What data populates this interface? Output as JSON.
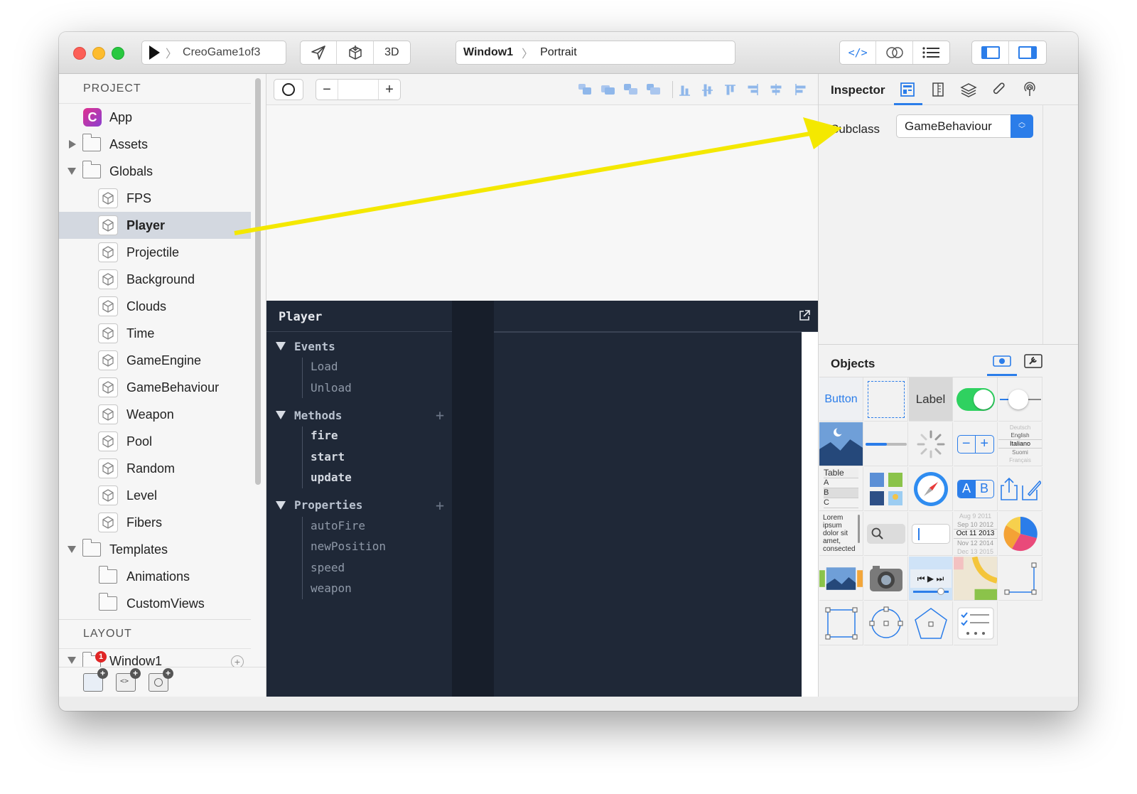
{
  "toolbar": {
    "scheme": "CreoGame1of3",
    "mode_3d": "3D",
    "breadcrumb_window": "Window1",
    "breadcrumb_orientation": "Portrait",
    "code_label": "</>"
  },
  "sidebar": {
    "project_header": "PROJECT",
    "layout_header": "LAYOUT",
    "items": [
      {
        "label": "App",
        "kind": "app"
      },
      {
        "label": "Assets",
        "kind": "folder-closed"
      },
      {
        "label": "Globals",
        "kind": "folder-open"
      },
      {
        "label": "FPS",
        "kind": "class"
      },
      {
        "label": "Player",
        "kind": "class",
        "selected": true
      },
      {
        "label": "Projectile",
        "kind": "class"
      },
      {
        "label": "Background",
        "kind": "class"
      },
      {
        "label": "Clouds",
        "kind": "class"
      },
      {
        "label": "Time",
        "kind": "class"
      },
      {
        "label": "GameEngine",
        "kind": "class"
      },
      {
        "label": "GameBehaviour",
        "kind": "class"
      },
      {
        "label": "Weapon",
        "kind": "class"
      },
      {
        "label": "Pool",
        "kind": "class"
      },
      {
        "label": "Random",
        "kind": "class"
      },
      {
        "label": "Level",
        "kind": "class"
      },
      {
        "label": "Fibers",
        "kind": "class"
      },
      {
        "label": "Templates",
        "kind": "folder-open"
      },
      {
        "label": "Animations",
        "kind": "subfolder"
      },
      {
        "label": "CustomViews",
        "kind": "subfolder"
      }
    ],
    "layout_items": [
      {
        "label": "Window1",
        "badge": "1"
      }
    ],
    "app_icon_letter": "C"
  },
  "editor": {
    "title": "Player",
    "groups": [
      {
        "label": "Events",
        "items": [
          "Load",
          "Unload"
        ],
        "bold": false,
        "addable": false
      },
      {
        "label": "Methods",
        "items": [
          "fire",
          "start",
          "update"
        ],
        "bold": true,
        "addable": true
      },
      {
        "label": "Properties",
        "items": [
          "autoFire",
          "newPosition",
          "speed",
          "weapon"
        ],
        "bold": false,
        "addable": true
      }
    ],
    "add_symbol": "+"
  },
  "inspector": {
    "title": "Inspector",
    "subclass_label": "Subclass",
    "subclass_value": "GameBehaviour"
  },
  "objects": {
    "title": "Objects",
    "button_label": "Button",
    "label_label": "Label",
    "table_header": "Table",
    "table_rows": [
      "A",
      "B",
      "C"
    ],
    "picker_items": [
      "Deutsch",
      "English",
      "Italiano",
      "Suomi",
      "Français"
    ],
    "lorem": "Lorem ipsum dolor sit amet, consected",
    "date_rows": [
      "Aug  9 2011",
      "Sep 10 2012",
      "Oct  11 2013",
      "Nov 12 2014",
      "Dec 13 2015"
    ],
    "segment_a": "A",
    "segment_b": "B"
  },
  "colors": {
    "accent": "#2b7de9",
    "editor_bg": "#1f2837",
    "annotation_arrow": "#f4e800",
    "selected_row": "#d3d8e0"
  }
}
